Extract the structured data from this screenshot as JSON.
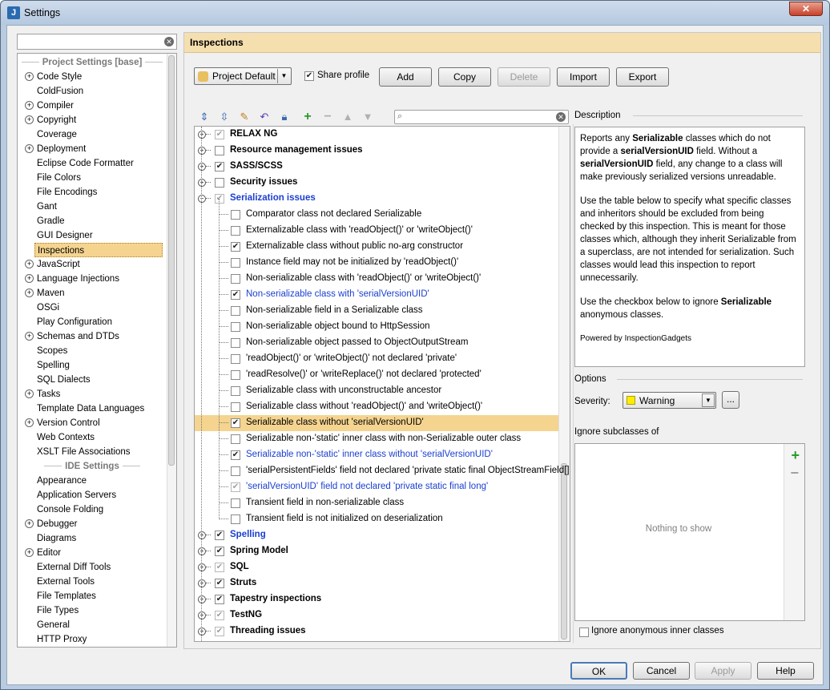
{
  "window": {
    "title": "Settings",
    "app_icon": "intellij-icon",
    "close_icon": "close-icon"
  },
  "left": {
    "search_placeholder": "",
    "project_header": "Project Settings [base]",
    "ide_header": "IDE Settings",
    "project_items": [
      {
        "label": "Code Style",
        "expandable": true
      },
      {
        "label": "ColdFusion",
        "expandable": false
      },
      {
        "label": "Compiler",
        "expandable": true
      },
      {
        "label": "Copyright",
        "expandable": true
      },
      {
        "label": "Coverage",
        "expandable": false
      },
      {
        "label": "Deployment",
        "expandable": true
      },
      {
        "label": "Eclipse Code Formatter",
        "expandable": false
      },
      {
        "label": "File Colors",
        "expandable": false
      },
      {
        "label": "File Encodings",
        "expandable": false
      },
      {
        "label": "Gant",
        "expandable": false
      },
      {
        "label": "Gradle",
        "expandable": false
      },
      {
        "label": "GUI Designer",
        "expandable": false
      },
      {
        "label": "Inspections",
        "expandable": false,
        "selected": true
      },
      {
        "label": "JavaScript",
        "expandable": true
      },
      {
        "label": "Language Injections",
        "expandable": true
      },
      {
        "label": "Maven",
        "expandable": true
      },
      {
        "label": "OSGi",
        "expandable": false
      },
      {
        "label": "Play Configuration",
        "expandable": false
      },
      {
        "label": "Schemas and DTDs",
        "expandable": true
      },
      {
        "label": "Scopes",
        "expandable": false
      },
      {
        "label": "Spelling",
        "expandable": false
      },
      {
        "label": "SQL Dialects",
        "expandable": false
      },
      {
        "label": "Tasks",
        "expandable": true
      },
      {
        "label": "Template Data Languages",
        "expandable": false
      },
      {
        "label": "Version Control",
        "expandable": true
      },
      {
        "label": "Web Contexts",
        "expandable": false
      },
      {
        "label": "XSLT File Associations",
        "expandable": false
      }
    ],
    "ide_items": [
      {
        "label": "Appearance",
        "expandable": false
      },
      {
        "label": "Application Servers",
        "expandable": false
      },
      {
        "label": "Console Folding",
        "expandable": false
      },
      {
        "label": "Debugger",
        "expandable": true
      },
      {
        "label": "Diagrams",
        "expandable": false
      },
      {
        "label": "Editor",
        "expandable": true
      },
      {
        "label": "External Diff Tools",
        "expandable": false
      },
      {
        "label": "External Tools",
        "expandable": false
      },
      {
        "label": "File Templates",
        "expandable": false
      },
      {
        "label": "File Types",
        "expandable": false
      },
      {
        "label": "General",
        "expandable": false
      },
      {
        "label": "HTTP Proxy",
        "expandable": false
      }
    ]
  },
  "panel": {
    "header": "Inspections",
    "profile": "Project Default",
    "share_profile": "Share profile",
    "share_checked": true,
    "buttons": {
      "add": "Add",
      "copy": "Copy",
      "delete": "Delete",
      "import": "Import",
      "export": "Export"
    },
    "toolbar_icons": [
      "expand-all-icon",
      "collapse-all-icon",
      "edit-icon",
      "reset-icon",
      "lock-icon",
      "add-icon",
      "remove-icon",
      "move-up-icon",
      "move-down-icon"
    ],
    "filter_placeholder": "",
    "rows": [
      {
        "level": 0,
        "label": "RELAX NG",
        "check": "gray",
        "bold": true
      },
      {
        "level": 0,
        "label": "Resource management issues",
        "check": "none",
        "bold": true
      },
      {
        "level": 0,
        "label": "SASS/SCSS",
        "check": "on",
        "bold": true
      },
      {
        "level": 0,
        "label": "Security issues",
        "check": "none",
        "bold": true
      },
      {
        "level": 0,
        "label": "Serialization issues",
        "check": "gray",
        "bold": true,
        "blue": true,
        "expanded": true
      },
      {
        "level": 1,
        "label": "Comparator class not declared Serializable",
        "check": "none"
      },
      {
        "level": 1,
        "label": "Externalizable class with 'readObject()' or 'writeObject()'",
        "check": "none"
      },
      {
        "level": 1,
        "label": "Externalizable class without public no-arg constructor",
        "check": "on"
      },
      {
        "level": 1,
        "label": "Instance field may not be initialized by 'readObject()'",
        "check": "none"
      },
      {
        "level": 1,
        "label": "Non-serializable class with 'readObject()' or 'writeObject()'",
        "check": "none"
      },
      {
        "level": 1,
        "label": "Non-serializable class with 'serialVersionUID'",
        "check": "on",
        "blue": true
      },
      {
        "level": 1,
        "label": "Non-serializable field in a Serializable class",
        "check": "none"
      },
      {
        "level": 1,
        "label": "Non-serializable object bound to HttpSession",
        "check": "none"
      },
      {
        "level": 1,
        "label": "Non-serializable object passed to ObjectOutputStream",
        "check": "none"
      },
      {
        "level": 1,
        "label": "'readObject()' or 'writeObject()' not declared 'private'",
        "check": "none"
      },
      {
        "level": 1,
        "label": "'readResolve()' or 'writeReplace()' not declared 'protected'",
        "check": "none"
      },
      {
        "level": 1,
        "label": "Serializable class with unconstructable ancestor",
        "check": "none"
      },
      {
        "level": 1,
        "label": "Serializable class without 'readObject()' and 'writeObject()'",
        "check": "none"
      },
      {
        "level": 1,
        "label": "Serializable class without 'serialVersionUID'",
        "check": "on",
        "selected": true
      },
      {
        "level": 1,
        "label": "Serializable non-'static' inner class with non-Serializable outer class",
        "check": "none"
      },
      {
        "level": 1,
        "label": "Serializable non-'static' inner class without 'serialVersionUID'",
        "check": "on",
        "blue": true
      },
      {
        "level": 1,
        "label": "'serialPersistentFields' field not declared 'private static final ObjectStreamField[]'",
        "check": "none"
      },
      {
        "level": 1,
        "label": "'serialVersionUID' field not declared 'private static final long'",
        "check": "gray",
        "blue": true
      },
      {
        "level": 1,
        "label": "Transient field in non-serializable class",
        "check": "none"
      },
      {
        "level": 1,
        "label": "Transient field is not initialized on deserialization",
        "check": "none"
      },
      {
        "level": 0,
        "label": "Spelling",
        "check": "on",
        "bold": true,
        "blue": true
      },
      {
        "level": 0,
        "label": "Spring Model",
        "check": "on",
        "bold": true
      },
      {
        "level": 0,
        "label": "SQL",
        "check": "gray",
        "bold": true
      },
      {
        "level": 0,
        "label": "Struts",
        "check": "on",
        "bold": true
      },
      {
        "level": 0,
        "label": "Tapestry inspections",
        "check": "on",
        "bold": true
      },
      {
        "level": 0,
        "label": "TestNG",
        "check": "gray",
        "bold": true
      },
      {
        "level": 0,
        "label": "Threading issues",
        "check": "gray",
        "bold": true
      }
    ],
    "description": {
      "label": "Description",
      "p1_a": "Reports any ",
      "p1_b": "Serializable",
      "p1_c": " classes which do not provide a ",
      "p1_d": "serialVersionUID",
      "p1_e": " field. Without a ",
      "p1_f": "serialVersionUID",
      "p1_g": " field, any change to a class will make previously serialized versions unreadable.",
      "p2": "Use the table below to specify what specific classes and inheritors should be excluded from being checked by this inspection. This is meant for those classes which, although they inherit Serializable from a superclass, are not intended for serialization. Such classes would lead this inspection to report unnecessarily.",
      "p3_a": "Use the checkbox below to ignore ",
      "p3_b": "Serializable",
      "p3_c": " anonymous classes.",
      "powered": "Powered by InspectionGadgets"
    },
    "options_label": "Options",
    "severity_label": "Severity:",
    "severity_value": "Warning",
    "severity_color": "#ffee00",
    "severity_more": "...",
    "ignore_label": "Ignore subclasses of",
    "nothing": "Nothing to show",
    "anon_label": "Ignore anonymous inner classes",
    "anon_checked": false
  },
  "footer": {
    "ok": "OK",
    "cancel": "Cancel",
    "apply": "Apply",
    "help": "Help"
  }
}
